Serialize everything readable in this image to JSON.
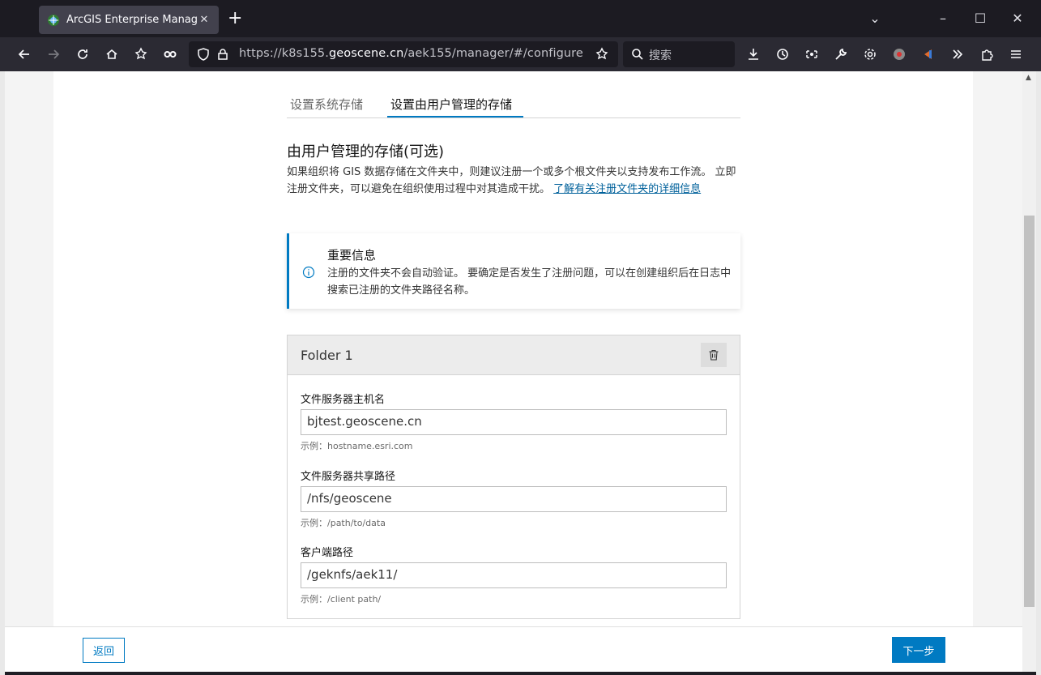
{
  "browser": {
    "tab_title": "ArcGIS Enterprise Manager",
    "url_prefix": "https://k8s155.",
    "url_host": "geoscene.cn",
    "url_path": "/aek155/manager/#/configure",
    "search_placeholder": "搜索"
  },
  "page": {
    "tabs": [
      "设置系统存储",
      "设置由用户管理的存储"
    ],
    "active_tab": 1,
    "section_title": "由用户管理的存储(可选)",
    "section_desc": "如果组织将 GIS 数据存储在文件夹中，则建议注册一个或多个根文件夹以支持发布工作流。 立即注册文件夹，可以避免在组织使用过程中对其造成干扰。 ",
    "learn_more_link": "了解有关注册文件夹的详细信息",
    "notice": {
      "title": "重要信息",
      "text": "注册的文件夹不会自动验证。 要确定是否发生了注册问题，可以在创建组织后在日志中搜索已注册的文件夹路径名称。"
    },
    "folder": {
      "title": "Folder 1",
      "fields": [
        {
          "label": "文件服务器主机名",
          "value": "bjtest.geoscene.cn",
          "hint": "示例：hostname.esri.com"
        },
        {
          "label": "文件服务器共享路径",
          "value": "/nfs/geoscene",
          "hint": "示例：/path/to/data"
        },
        {
          "label": "客户端路径",
          "value": "/geknfs/aek11/",
          "hint": "示例：/client path/"
        }
      ]
    }
  },
  "footer": {
    "back_label": "返回",
    "next_label": "下一步"
  },
  "colors": {
    "accent": "#007ac2",
    "link": "#00619b"
  }
}
